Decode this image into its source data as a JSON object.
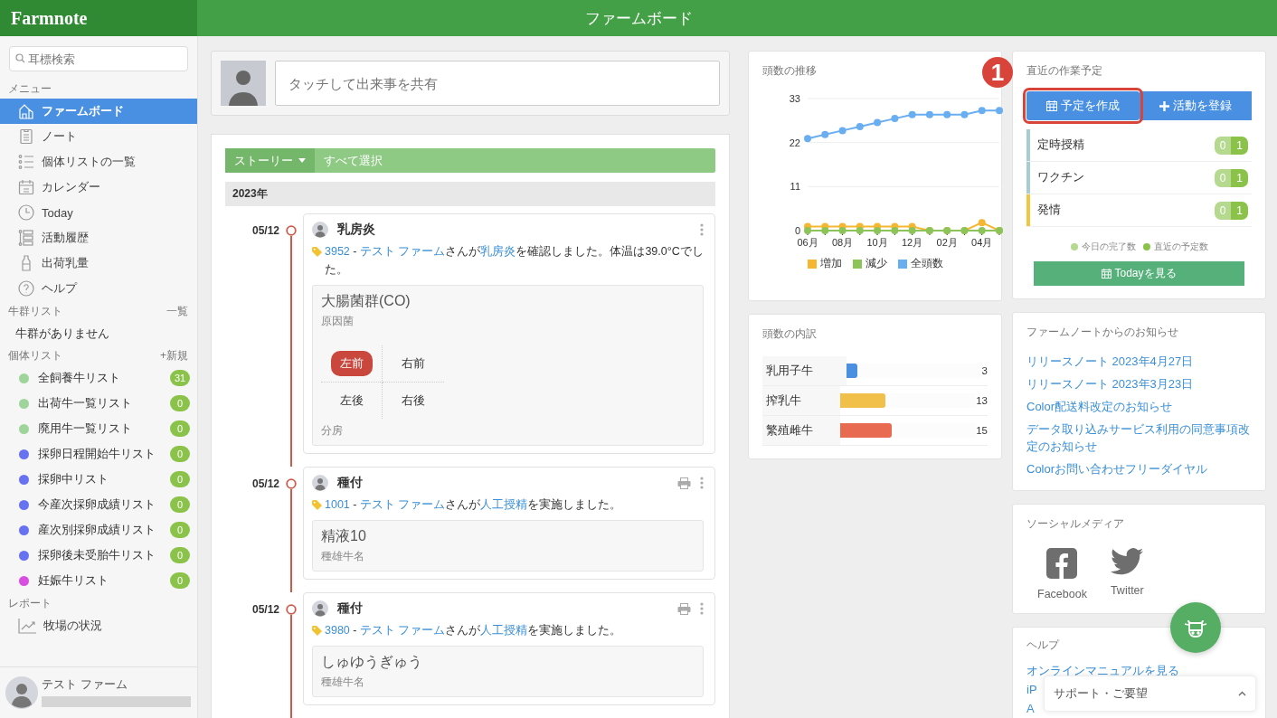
{
  "header": {
    "logo": "Farmnote",
    "title": "ファームボード"
  },
  "sidebar": {
    "search": {
      "placeholder": "耳標検索"
    },
    "menu_heading": "メニュー",
    "menu": [
      {
        "label": "ファームボード",
        "selected": true
      },
      {
        "label": "ノート",
        "selected": false
      },
      {
        "label": "個体リストの一覧",
        "selected": false
      },
      {
        "label": "カレンダー",
        "selected": false
      },
      {
        "label": "Today",
        "selected": false
      },
      {
        "label": "活動履歴",
        "selected": false
      },
      {
        "label": "出荷乳量",
        "selected": false
      },
      {
        "label": "ヘルプ",
        "selected": false
      }
    ],
    "herd_heading": "牛群リスト",
    "herd_action": "一覧",
    "herd_empty": "牛群がありません",
    "list_heading": "個体リスト",
    "list_action": "+新規",
    "lists": [
      {
        "label": "全飼養牛リスト",
        "count": "31",
        "color": "#9fd49a"
      },
      {
        "label": "出荷牛一覧リスト",
        "count": "0",
        "color": "#9fd49a"
      },
      {
        "label": "廃用牛一覧リスト",
        "count": "0",
        "color": "#9fd49a"
      },
      {
        "label": "採卵日程開始牛リスト",
        "count": "0",
        "color": "#6672f2"
      },
      {
        "label": "採卵中リスト",
        "count": "0",
        "color": "#6672f2"
      },
      {
        "label": "今産次採卵成績リスト",
        "count": "0",
        "color": "#6672f2"
      },
      {
        "label": "産次別採卵成績リスト",
        "count": "0",
        "color": "#6672f2"
      },
      {
        "label": "採卵後未受胎牛リスト",
        "count": "0",
        "color": "#6672f2"
      },
      {
        "label": "妊娠牛リスト",
        "count": "0",
        "color": "#d84ee0"
      }
    ],
    "report_heading": "レポート",
    "reports": [
      {
        "label": "牧場の状況"
      }
    ],
    "user": {
      "name": "テスト ファーム"
    }
  },
  "post": {
    "placeholder": "タッチして出来事を共有"
  },
  "timeline": {
    "filter": "ストーリー",
    "select_all": "すべて選択",
    "year": "2023年",
    "entries": [
      {
        "date": "05/12",
        "title": "乳房炎",
        "printable": false,
        "text": [
          {
            "t": "3952",
            "kind": "link"
          },
          {
            "t": " - ",
            "kind": "plain"
          },
          {
            "t": "テスト ファーム",
            "kind": "link"
          },
          {
            "t": "さんが",
            "kind": "plain"
          },
          {
            "t": "乳房炎",
            "kind": "link"
          },
          {
            "t": "を確認しました。体温は39.0°Cでした。",
            "kind": "plain"
          }
        ],
        "value": "大腸菌群(CO)",
        "value_label": "原因菌",
        "quarters": [
          {
            "label": "左前",
            "selected": true
          },
          {
            "label": "右前",
            "selected": false
          },
          {
            "label": "左後",
            "selected": false
          },
          {
            "label": "右後",
            "selected": false
          }
        ],
        "quarters_label": "分房"
      },
      {
        "date": "05/12",
        "title": "種付",
        "printable": true,
        "text": [
          {
            "t": "1001",
            "kind": "link"
          },
          {
            "t": " - ",
            "kind": "plain"
          },
          {
            "t": "テスト ファーム",
            "kind": "link"
          },
          {
            "t": "さんが",
            "kind": "plain"
          },
          {
            "t": "人工授精",
            "kind": "link"
          },
          {
            "t": "を実施しました。",
            "kind": "plain"
          }
        ],
        "value": "精液10",
        "value_label": "種雄牛名"
      },
      {
        "date": "05/12",
        "title": "種付",
        "printable": true,
        "text": [
          {
            "t": "3980",
            "kind": "link"
          },
          {
            "t": " - ",
            "kind": "plain"
          },
          {
            "t": "テスト ファーム",
            "kind": "link"
          },
          {
            "t": "さんが",
            "kind": "plain"
          },
          {
            "t": "人工授精",
            "kind": "link"
          },
          {
            "t": "を実施しました。",
            "kind": "plain"
          }
        ],
        "value": "しゅゆうぎゅう",
        "value_label": "種雄牛名"
      }
    ]
  },
  "trend": {
    "title": "頭数の推移",
    "chart_data": {
      "type": "line",
      "categories": [
        "06月",
        null,
        "08月",
        null,
        "10月",
        null,
        "12月",
        null,
        "02月",
        null,
        "04月",
        null
      ],
      "series": [
        {
          "name": "増加",
          "color": "#f5b731",
          "marker": "circle",
          "values": [
            1,
            1,
            1,
            1,
            1,
            1,
            1,
            0,
            0,
            0,
            2,
            0
          ]
        },
        {
          "name": "減少",
          "color": "#8dc45a",
          "marker": "circle",
          "values": [
            0,
            0,
            0,
            0,
            0,
            0,
            0,
            0,
            0,
            0,
            0,
            0
          ]
        },
        {
          "name": "全頭数",
          "color": "#6aaef2",
          "marker": "circle",
          "values": [
            23,
            24,
            25,
            26,
            27,
            28,
            29,
            29,
            29,
            29,
            30,
            30
          ]
        }
      ],
      "ylim": [
        0,
        33
      ],
      "yticks": [
        0,
        11,
        22,
        33
      ]
    }
  },
  "breakdown": {
    "title": "頭数の内訳",
    "rows": [
      {
        "label": "乳用子牛",
        "count": "3",
        "level": 0.08,
        "color": "#4a8fe0"
      },
      {
        "label": "搾乳牛",
        "count": "13",
        "level": 0.33,
        "color": "#f0c04a"
      },
      {
        "label": "繁殖雌牛",
        "count": "15",
        "level": 0.38,
        "color": "#e86a50"
      }
    ]
  },
  "schedule": {
    "title": "直近の作業予定",
    "buttons": [
      {
        "label": "予定を作成",
        "highlighted": true
      },
      {
        "label": "活動を登録",
        "highlighted": false
      }
    ],
    "annotation": "1",
    "tasks": [
      {
        "label": "定時授精",
        "done": "0",
        "planned": "1",
        "color": "#a8ccd0"
      },
      {
        "label": "ワクチン",
        "done": "0",
        "planned": "1",
        "color": "#a8ccd0"
      },
      {
        "label": "発情",
        "done": "0",
        "planned": "1",
        "color": "#f1c53c"
      }
    ],
    "legend": [
      {
        "label": "今日の完了数",
        "color": "#b5d98f"
      },
      {
        "label": "直近の予定数",
        "color": "#8bc34a"
      }
    ],
    "today_button": "Todayを見る"
  },
  "news": {
    "title": "ファームノートからのお知らせ",
    "links": [
      "リリースノート 2023年4月27日",
      "リリースノート 2023年3月23日",
      "Color配送料改定のお知らせ",
      "データ取り込みサービス利用の同意事項改定のお知らせ",
      "Colorお問い合わせフリーダイヤル"
    ]
  },
  "social": {
    "title": "ソーシャルメディア",
    "items": [
      {
        "label": "Facebook"
      },
      {
        "label": "Twitter"
      }
    ]
  },
  "help": {
    "title": "ヘルプ",
    "links": [
      "オンラインマニュアルを見る",
      "iP",
      "A"
    ]
  },
  "support": {
    "label": "サポート・ご要望"
  }
}
